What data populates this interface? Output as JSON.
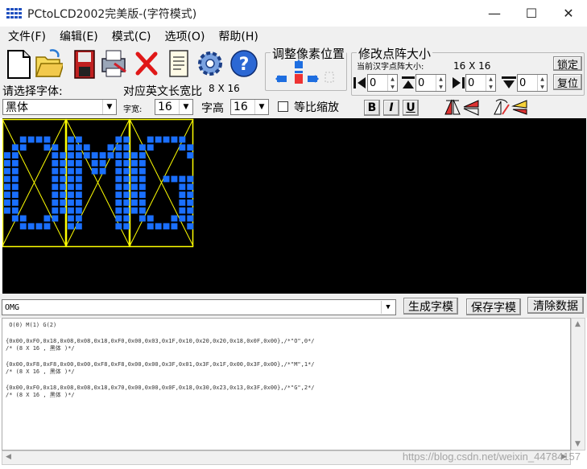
{
  "window": {
    "title": "PCtoLCD2002完美版-(字符模式)",
    "minimize": "—",
    "maximize": "☐",
    "close": "✕"
  },
  "menu": [
    "文件(F)",
    "编辑(E)",
    "模式(C)",
    "选项(O)",
    "帮助(H)"
  ],
  "toolbar": {
    "icons": [
      "new-icon",
      "open-icon",
      "save-icon",
      "print-icon",
      "delete-icon",
      "notes-icon",
      "settings-gear-icon",
      "help-icon"
    ],
    "adjust_group_title": "调整像素位置",
    "resize_group_title": "修改点阵大小",
    "current_size_label": "当前汉字点阵大小:",
    "current_size_value": "16 X 16",
    "lock_button": "锁定",
    "restore_button": "复位",
    "spin_values": [
      "0",
      "0",
      "0",
      "0"
    ],
    "font_select_label": "请选择字体:",
    "font_value": "黑体",
    "ratio_label": "对应英文长宽比",
    "ratio_value": "8 X 16",
    "width_label": "字宽:",
    "width_value": "16",
    "height_label": "字高",
    "height_value": "16",
    "proportional_label": "等比缩放",
    "bold": "B",
    "italic": "I",
    "underline": "U"
  },
  "canvas": {
    "text": "OMG",
    "grid_color": "#ffff00",
    "dot_color": "#1a6fff",
    "background": "#000000"
  },
  "bottom": {
    "input_value": "OMG",
    "generate_button": "生成字模",
    "save_button": "保存字模",
    "clear_button": "清除数据"
  },
  "output": {
    "lines": [
      " O(0) M(1) G(2)",
      "",
      "{0x00,0xF0,0x18,0x08,0x08,0x18,0xF0,0x00,0x03,0x1F,0x10,0x20,0x20,0x18,0x0F,0x00},/*\"O\",0*/",
      "/* (8 X 16 , 黑体 )*/",
      "",
      "{0x00,0xF8,0xF8,0x00,0x00,0xF8,0xF8,0x00,0x00,0x3F,0x01,0x3F,0x1F,0x00,0x3F,0x00},/*\"M\",1*/",
      "/* (8 X 16 , 黑体 )*/",
      "",
      "{0x00,0xF0,0x18,0x08,0x08,0x18,0x70,0x00,0x00,0x0F,0x18,0x30,0x23,0x13,0x3F,0x00},/*\"G\",2*/",
      "/* (8 X 16 , 黑体 )*/"
    ]
  },
  "watermark": "https://blog.csdn.net/weixin_44784157"
}
